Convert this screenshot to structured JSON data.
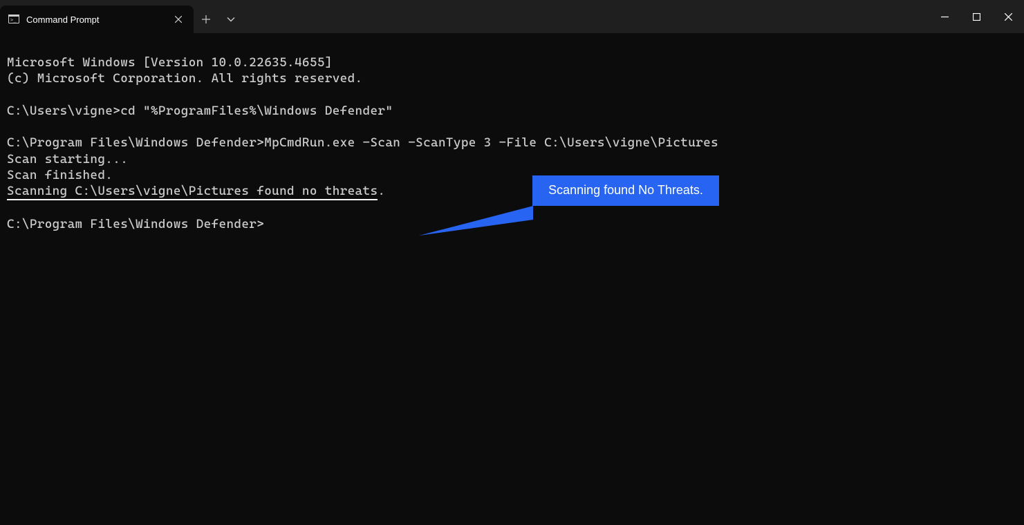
{
  "titlebar": {
    "tab_title": "Command Prompt"
  },
  "terminal": {
    "line1": "Microsoft Windows [Version 10.0.22635.4655]",
    "line2": "(c) Microsoft Corporation. All rights reserved.",
    "blank1": "",
    "line3_prompt": "C:\\Users\\vigne>",
    "line3_cmd": "cd \"%ProgramFiles%\\Windows Defender\"",
    "blank2": "",
    "line4_prompt": "C:\\Program Files\\Windows Defender>",
    "line4_cmd": "MpCmdRun.exe -Scan -ScanType 3 -File C:\\Users\\vigne\\Pictures",
    "line5": "Scan starting...",
    "line6": "Scan finished.",
    "line7": "Scanning C:\\Users\\vigne\\Pictures found no threats",
    "line7_dot": ".",
    "blank3": "",
    "line8_prompt": "C:\\Program Files\\Windows Defender>"
  },
  "callout": {
    "text": "Scanning found No Threats."
  }
}
